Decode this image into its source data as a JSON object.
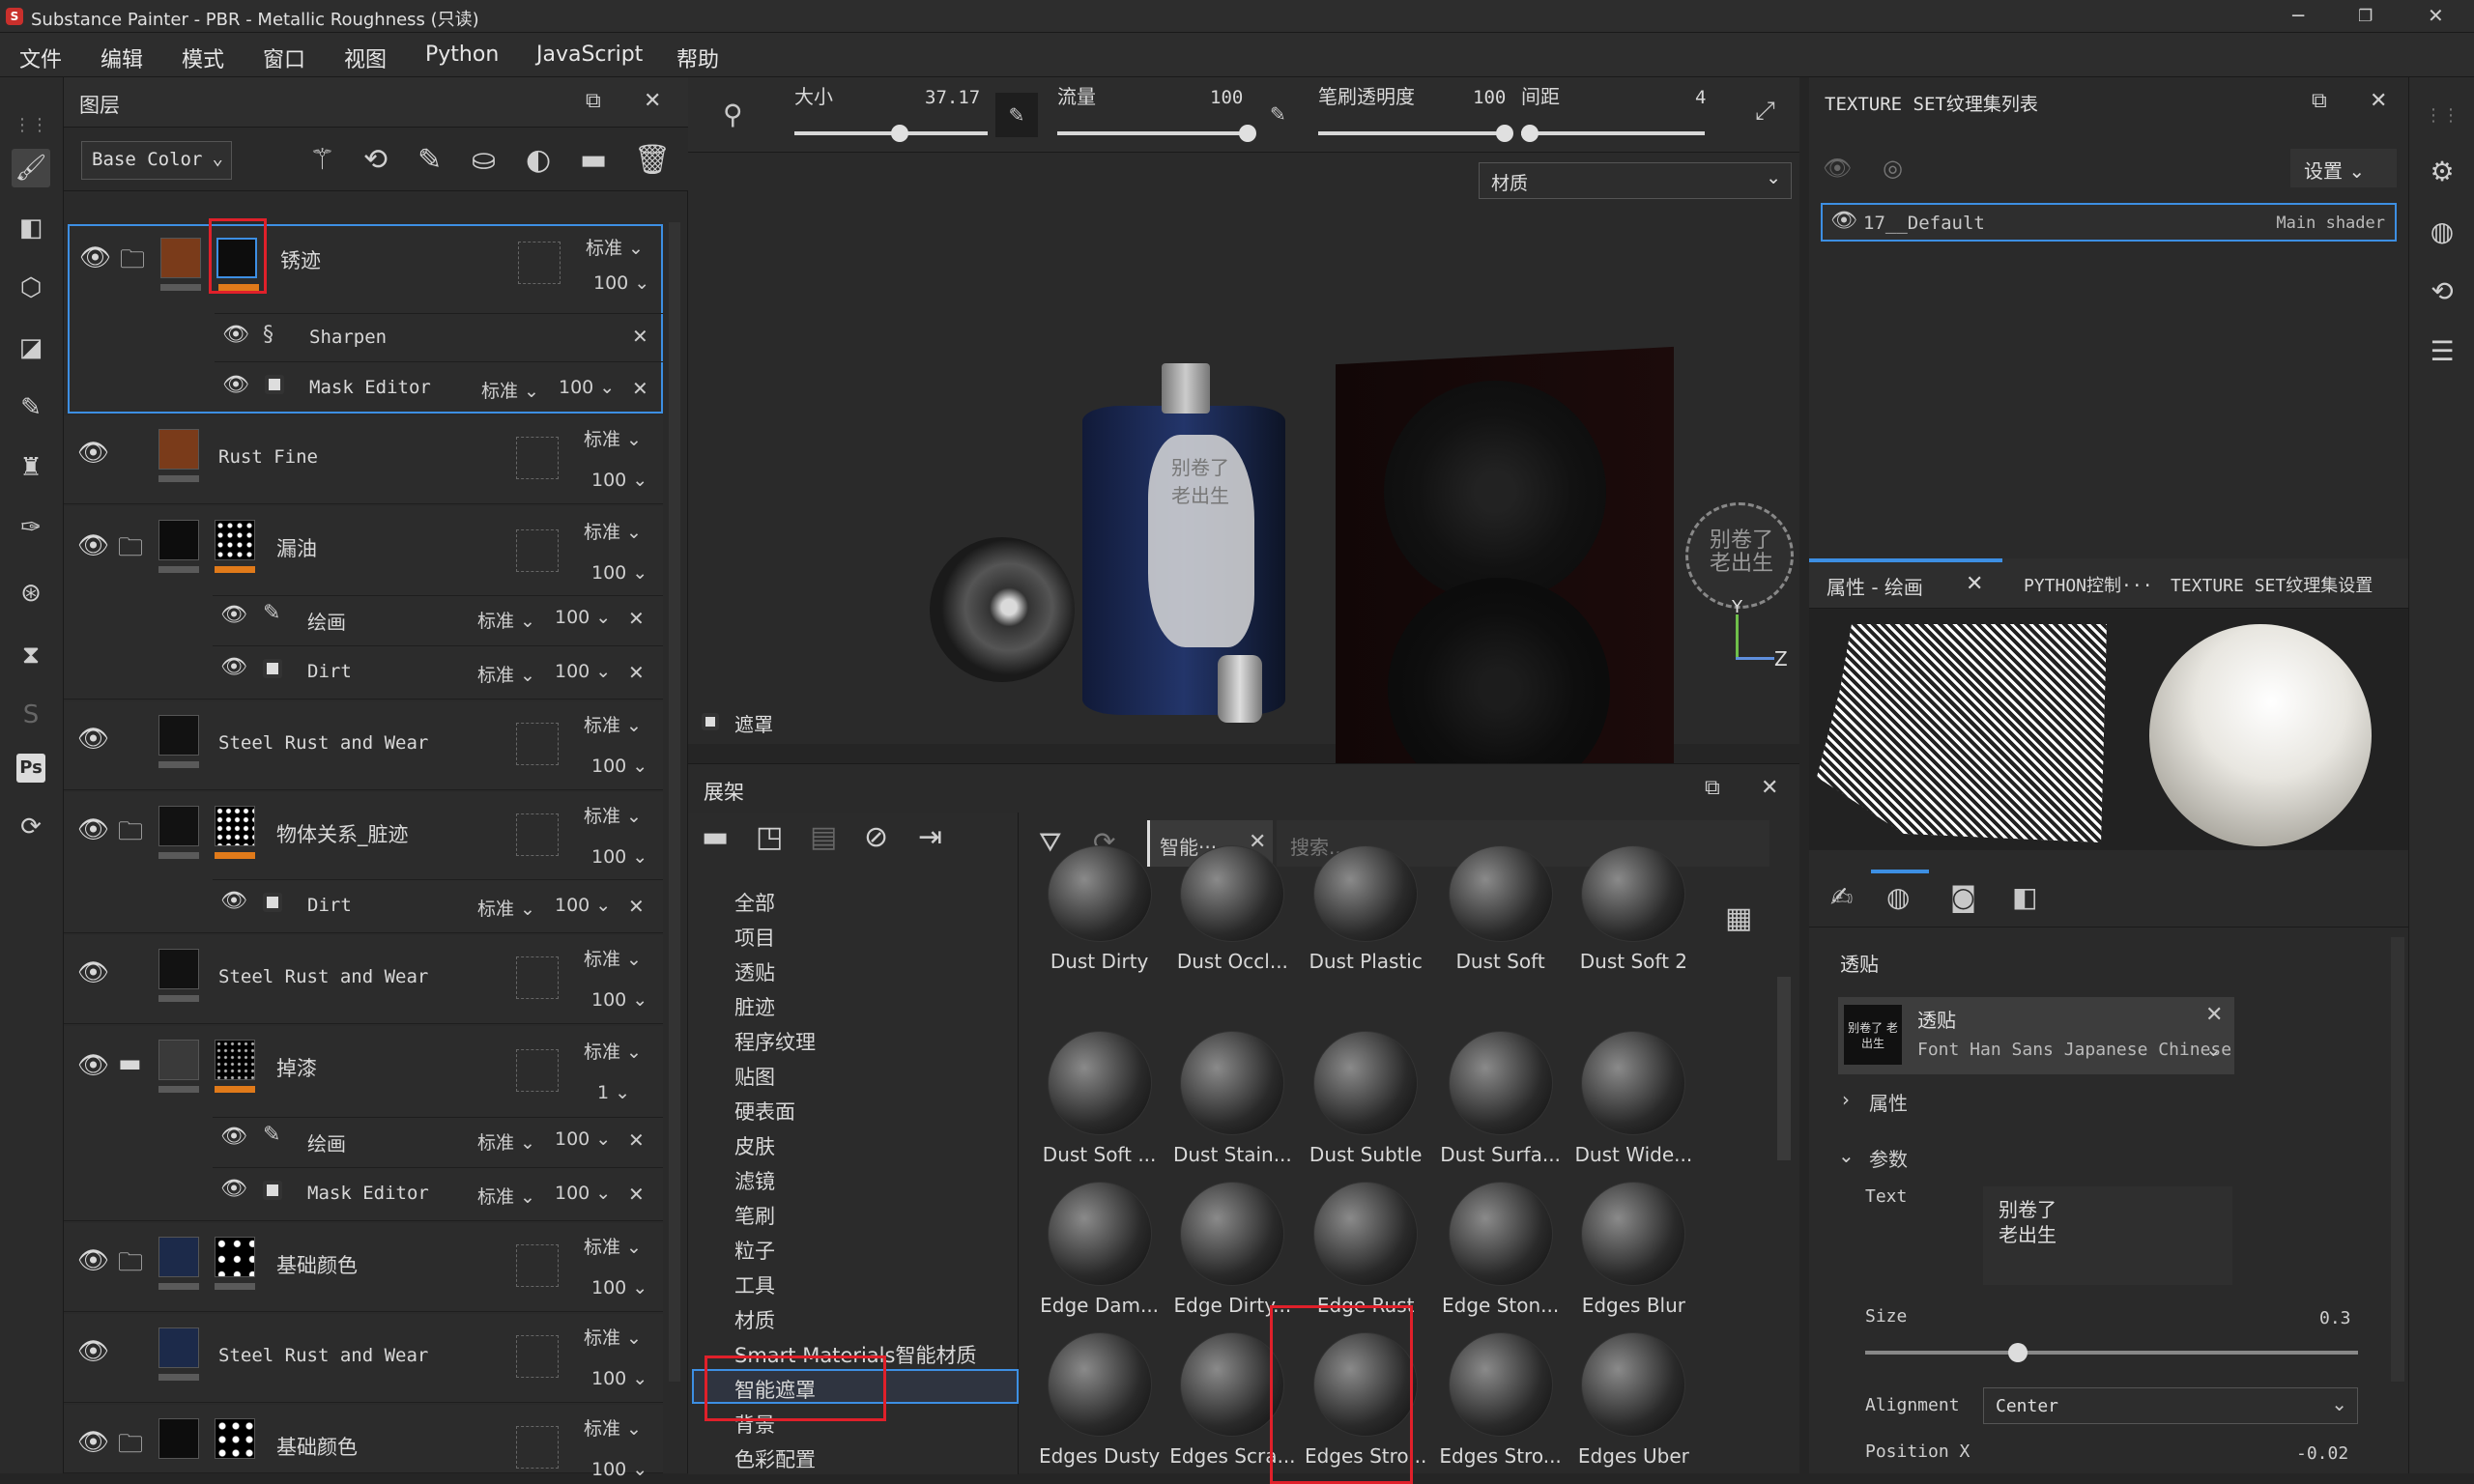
{
  "window": {
    "title": "Substance Painter - PBR - Metallic Roughness (只读)"
  },
  "menu": [
    "文件",
    "编辑",
    "模式",
    "窗口",
    "视图",
    "Python",
    "JavaScript",
    "帮助"
  ],
  "layers_panel": {
    "title": "图层",
    "channel": "Base Color",
    "layers": [
      {
        "name": "锈迹",
        "blend": "标准",
        "opacity": "100",
        "effects": [
          {
            "name": "Sharpen"
          },
          {
            "name": "Mask Editor",
            "blend": "标准",
            "opacity": "100"
          }
        ]
      },
      {
        "name": "Rust Fine",
        "blend": "标准",
        "opacity": "100"
      },
      {
        "name": "漏油",
        "blend": "标准",
        "opacity": "100",
        "effects": [
          {
            "name": "绘画",
            "blend": "标准",
            "opacity": "100"
          },
          {
            "name": "Dirt",
            "blend": "标准",
            "opacity": "100"
          }
        ]
      },
      {
        "name": "Steel Rust and Wear",
        "blend": "标准",
        "opacity": "100"
      },
      {
        "name": "物体关系_脏迹",
        "blend": "标准",
        "opacity": "100",
        "effects": [
          {
            "name": "Dirt",
            "blend": "标准",
            "opacity": "100"
          }
        ]
      },
      {
        "name": "Steel Rust and Wear",
        "blend": "标准",
        "opacity": "100"
      },
      {
        "name": "掉漆",
        "blend": "标准",
        "opacity": "1",
        "effects": [
          {
            "name": "绘画",
            "blend": "标准",
            "opacity": "100"
          },
          {
            "name": "Mask Editor",
            "blend": "标准",
            "opacity": "100"
          }
        ]
      },
      {
        "name": "基础颜色",
        "blend": "标准",
        "opacity": "100"
      },
      {
        "name": "Steel Rust and Wear",
        "blend": "标准",
        "opacity": "100"
      },
      {
        "name": "基础颜色",
        "blend": "标准",
        "opacity": "100"
      }
    ]
  },
  "viewport_toolbar": {
    "size_label": "大小",
    "size_value": "37.17",
    "flow_label": "流量",
    "flow_value": "100",
    "opacity_label": "笔刷透明度",
    "opacity_value": "100",
    "spacing_label": "间距",
    "spacing_value": "4",
    "material_select": "材质",
    "mask_label": "遮罩",
    "decal_text": "别卷了 老出生",
    "axis_y": "Y",
    "axis_z": "Z"
  },
  "shelf": {
    "title": "展架",
    "search_tag": "智能···",
    "search_placeholder": "搜索...",
    "categories": [
      "全部",
      "项目",
      "透贴",
      "脏迹",
      "程序纹理",
      "贴图",
      "硬表面",
      "皮肤",
      "滤镜",
      "笔刷",
      "粒子",
      "工具",
      "材质",
      "Smart Materials智能材质",
      "智能遮罩",
      "背景",
      "色彩配置"
    ],
    "items": [
      "Dust Dirty",
      "Dust Occl...",
      "Dust Plastic",
      "Dust Soft",
      "Dust Soft 2",
      "Dust Soft ...",
      "Dust Stain...",
      "Dust Subtle",
      "Dust Surfa...",
      "Dust Wide...",
      "Edge Dam...",
      "Edge Dirty...",
      "Edge Rust",
      "Edge Ston...",
      "Edges Blur",
      "Edges Dusty",
      "Edges Scra...",
      "Edges Stro...",
      "Edges Stro...",
      "Edges Uber"
    ]
  },
  "texture_set": {
    "title": "TEXTURE SET纹理集列表",
    "settings": "设置",
    "item_name": "17__Default",
    "item_shader": "Main shader"
  },
  "properties": {
    "tabs": [
      "属性 - 绘画",
      "PYTHON控制···",
      "TEXTURE SET纹理集设置"
    ],
    "section": "透贴",
    "decal_name": "透贴",
    "decal_font": "Font Han Sans Japanese Chinese",
    "decal_thumb": "别卷了 老出生",
    "attr_label": "属性",
    "param_label": "参数",
    "text_label": "Text",
    "text_value_1": "别卷了",
    "text_value_2": "老出生",
    "size_label": "Size",
    "size_value": "0.3",
    "align_label": "Alignment",
    "align_value": "Center",
    "posx_label": "Position X",
    "posx_value": "-0.02"
  }
}
